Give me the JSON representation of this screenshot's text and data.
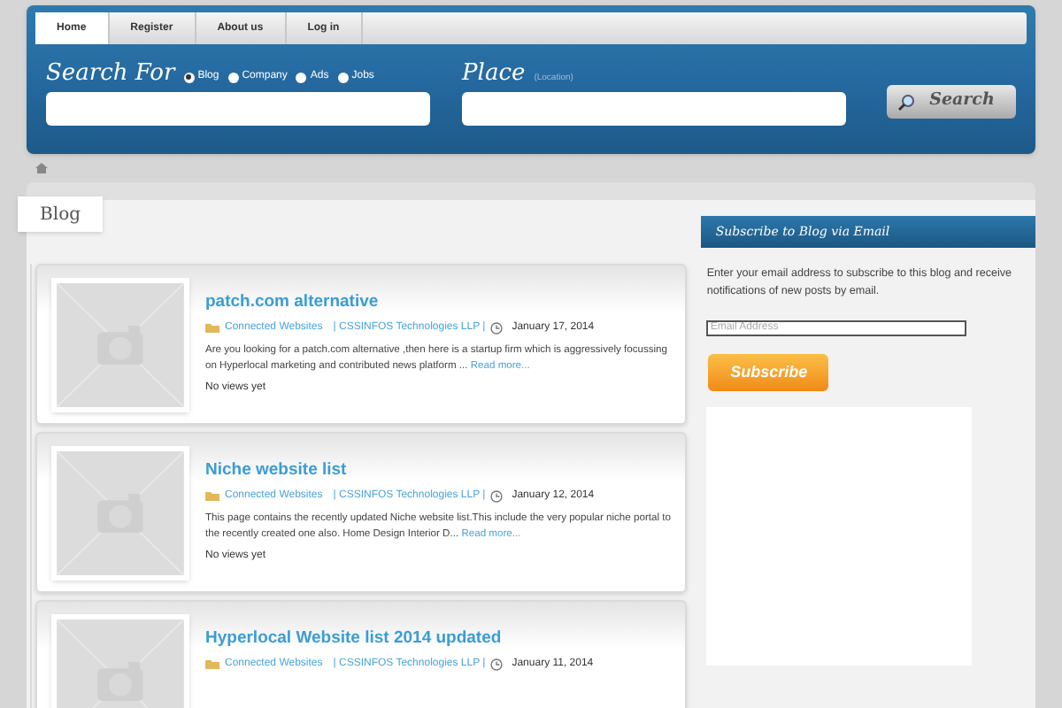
{
  "nav": [
    {
      "label": "Home",
      "selected": true
    },
    {
      "label": "Register",
      "selected": false
    },
    {
      "label": "About us",
      "selected": false
    },
    {
      "label": "Log in",
      "selected": false
    }
  ],
  "search": {
    "label": "Search For",
    "options": [
      {
        "label": "Blog",
        "selected": true
      },
      {
        "label": "Company",
        "selected": false
      },
      {
        "label": "Ads",
        "selected": false
      },
      {
        "label": "Jobs",
        "selected": false
      }
    ],
    "place_label": "Place",
    "place_hint": "(Location)",
    "button": "Search"
  },
  "section_tab": "Blog",
  "posts": [
    {
      "title": "patch.com alternative",
      "category": "Connected Websites",
      "author": "| CSSINFOS Technologies LLP |",
      "date": "January 17, 2014",
      "excerpt": "Are you looking for a patch.com alternative ,then here is a startup firm which is aggressively focussing on Hyperlocal marketing and contributed news platform  ...",
      "read_more": "Read more...",
      "views": "No views yet"
    },
    {
      "title": "Niche website list",
      "category": "Connected Websites",
      "author": "| CSSINFOS Technologies LLP |",
      "date": "January 12, 2014",
      "excerpt": "This page contains the recently updated Niche website list.This include the very popular niche portal to the recently created one also. Home Design Interior D...",
      "read_more": "Read more...",
      "views": "No views yet"
    },
    {
      "title": "Hyperlocal Website list 2014 updated",
      "category": "Connected Websites",
      "author": "| CSSINFOS Technologies LLP |",
      "date": "January 11, 2014"
    }
  ],
  "sidebar": {
    "title": "Subscribe to Blog via Email",
    "text": "Enter your email address to subscribe to this blog and receive notifications of new posts by email.",
    "placeholder": "Email Address",
    "button": "Subscribe"
  }
}
